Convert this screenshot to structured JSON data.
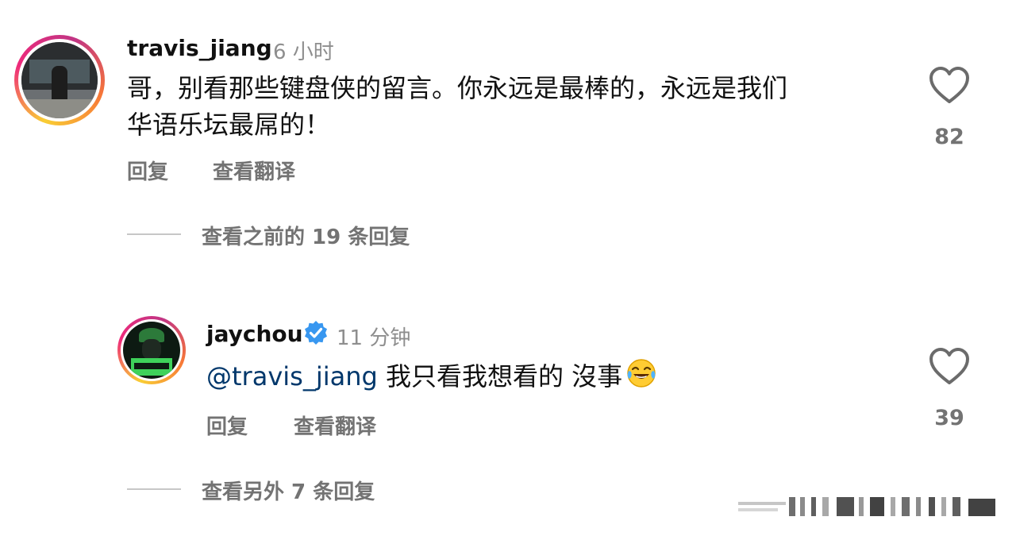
{
  "comments": [
    {
      "username": "travis_jiang",
      "time": "6 小时",
      "text_line1": "哥，别看那些键盘侠的留言。你永远是最棒的，永远是我们",
      "text_line2": "华语乐坛最屌的！",
      "like_count": "82",
      "reply_label": "回复",
      "translate_label": "查看翻译",
      "view_replies": "查看之前的 19 条回复"
    },
    {
      "username": "jaychou",
      "verified": true,
      "time": "11 分钟",
      "mention": "@travis_jiang",
      "text": " 我只看我想看的 沒事",
      "emoji": "face-with-tears-of-joy",
      "like_count": "39",
      "reply_label": "回复",
      "translate_label": "查看翻译",
      "view_replies": "查看另外 7 条回复"
    }
  ],
  "icons": {
    "heart": "heart-outline-icon",
    "verified": "verified-badge-icon"
  },
  "colors": {
    "mention": "#00376b",
    "verified": "#3897f0",
    "secondary_text": "#737373"
  }
}
